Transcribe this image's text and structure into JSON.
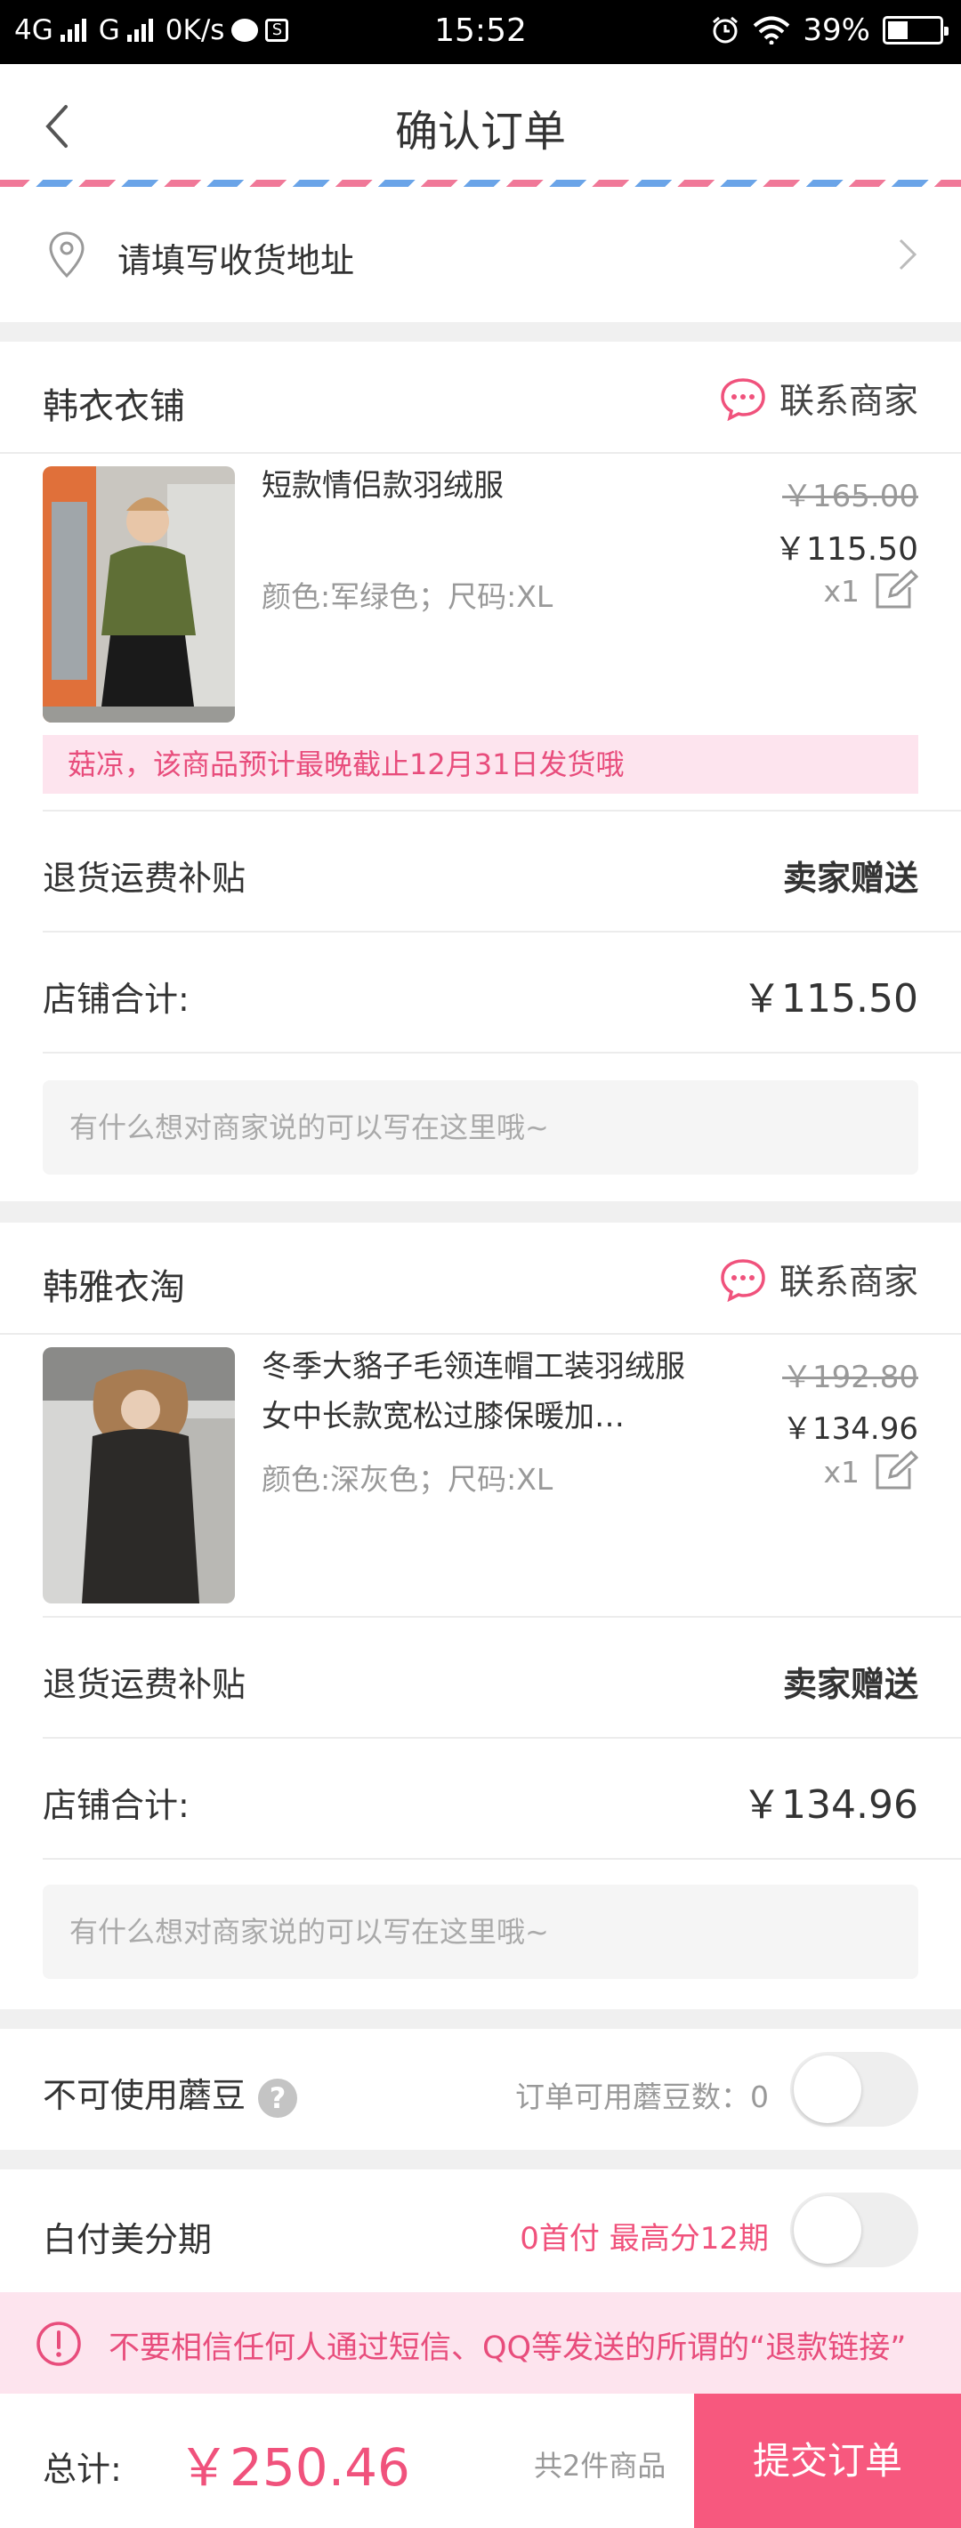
{
  "status_bar": {
    "network1": "4G",
    "network2": "G",
    "speed": "0K/s",
    "time": "15:52",
    "battery": "39%",
    "battery_level": 0.39
  },
  "header": {
    "title": "确认订单"
  },
  "address": {
    "placeholder_text": "请填写收货地址"
  },
  "shops": [
    {
      "name": "韩衣衣铺",
      "contact_label": "联系商家",
      "item": {
        "name": "短款情侣款羽绒服",
        "spec": "颜色:军绿色；尺码:XL",
        "original_price": "￥165.00",
        "price": "￥115.50",
        "quantity": "x1"
      },
      "shipping_notice": "菇凉，该商品预计最晚截止12月31日发货哦",
      "return_subsidy_label": "退货运费补贴",
      "return_subsidy_value": "卖家赠送",
      "subtotal_label": "店铺合计:",
      "subtotal_value": "￥115.50",
      "memo_placeholder": "有什么想对商家说的可以写在这里哦~"
    },
    {
      "name": "韩雅衣淘",
      "contact_label": "联系商家",
      "item": {
        "name": "冬季大貉子毛领连帽工装羽绒服女中长款宽松过膝保暖加…",
        "spec": "颜色:深灰色；尺码:XL",
        "original_price": "￥192.80",
        "price": "￥134.96",
        "quantity": "x1"
      },
      "return_subsidy_label": "退货运费补贴",
      "return_subsidy_value": "卖家赠送",
      "subtotal_label": "店铺合计:",
      "subtotal_value": "￥134.96",
      "memo_placeholder": "有什么想对商家说的可以写在这里哦~"
    }
  ],
  "mogu_beans": {
    "label": "不可使用蘑豆",
    "help": "?",
    "available_text": "订单可用蘑豆数：0"
  },
  "installment": {
    "label": "白付美分期",
    "promo": "0首付 最高分12期"
  },
  "warning": {
    "text": "不要相信任何人通过短信、QQ等发送的所谓的“退款链接”"
  },
  "footer": {
    "total_label": "总计:",
    "total_amount": "￥250.46",
    "item_count": "共2件商品",
    "submit_label": "提交订单"
  },
  "colors": {
    "accent": "#f7587e",
    "accent_text": "#e84d7c",
    "notice_bg": "#fde4ee"
  }
}
